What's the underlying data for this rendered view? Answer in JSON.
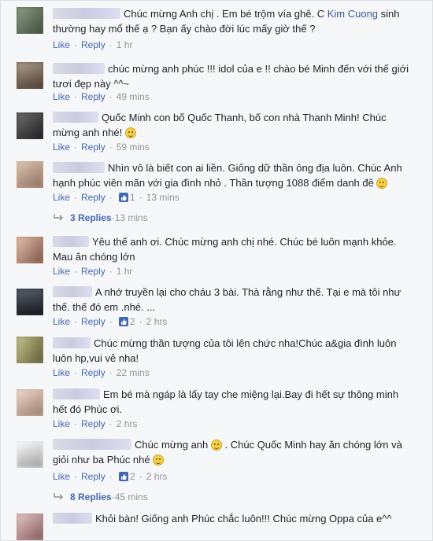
{
  "comments": [
    {
      "text_before_link": "Chúc mừng Anh chị . Em bé trộm vía ghê. C ",
      "link": "Kim Cuong",
      "text_after_link": " sinh thường hay mổ thế ạ ? Bạn ấy chào đời lúc mấy giờ thế ?",
      "like": "Like",
      "reply": "Reply",
      "time": "1 hr",
      "count": ""
    },
    {
      "text": "chúc mừng anh phúc !!! idol của e !! chào bé Minh đến với thế giới tươi đẹp này ^^~",
      "like": "Like",
      "reply": "Reply",
      "time": "49 mins",
      "count": ""
    },
    {
      "text": "Quốc Minh con bố Quốc Thanh, bố con nhà Thanh Minh! Chúc mừng anh nhé!",
      "like": "Like",
      "reply": "Reply",
      "time": "59 mins",
      "count": ""
    },
    {
      "text": "Nhìn vô là biết con ai liền. Giống dữ thần ông địa luôn. Chúc Anh hạnh phúc viên mãn với gia đình nhỏ . Thần tượng 1088 điểm danh đê",
      "like": "Like",
      "reply": "Reply",
      "time": "13 mins",
      "count": "1"
    },
    {
      "text": "Yêu thế anh ơi. Chúc mừng anh chị nhé. Chúc bé luôn mạnh khỏe. Mau ăn chóng lớn",
      "like": "Like",
      "reply": "Reply",
      "time": "1 hr",
      "count": ""
    },
    {
      "text": "A nhớ truyền lại cho cháu 3 bài. Thà rằng như thế. Tại e mà tôi như thế. thế đó em .nhé. ...",
      "like": "Like",
      "reply": "Reply",
      "time": "2 hrs",
      "count": "2"
    },
    {
      "text": "Chúc mừng thần tượng của tôi lên chức nha!Chúc a&gia đình luôn luôn hp,vui vẻ nha!",
      "like": "Like",
      "reply": "Reply",
      "time": "22 mins",
      "count": ""
    },
    {
      "text": "Em bé mà ngáp là lấy tay che miệng lại.Bay đi hết sự thông minh hết đó Phúc ơi.",
      "like": "Like",
      "reply": "Reply",
      "time": "2 hrs",
      "count": ""
    },
    {
      "text_a": "Chúc mừng anh ",
      "text_b": " . Chúc Quốc Minh hay ăn chóng lớn và giỏi như ba Phúc nhé ",
      "like": "Like",
      "reply": "Reply",
      "time": "2 hrs",
      "count": "2"
    },
    {
      "text": "Khỏi bàn! Giống anh Phúc chắc luôn!!! Chúc mừng Oppa của e^^"
    }
  ],
  "reply_threads": [
    {
      "label": "3 Replies",
      "time": "13 mins"
    },
    {
      "label": "8 Replies",
      "time": "45 mins"
    }
  ],
  "colors": {
    "link": "#4267b2",
    "meta": "#90949c",
    "text": "#1d2129",
    "background": "#f6f7f9"
  },
  "icons": [
    "like-icon",
    "reply-arrow-icon",
    "smile-emoji-icon",
    "grin-emoji-icon"
  ]
}
